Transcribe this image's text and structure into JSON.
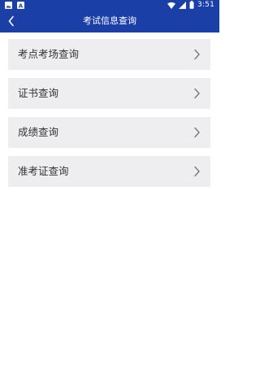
{
  "status_bar": {
    "time": "3:51",
    "left_icons": [
      "image-icon",
      "font-icon"
    ],
    "right_icons": [
      "wifi-icon",
      "signal-icon",
      "battery-icon"
    ]
  },
  "app_bar": {
    "title": "考试信息查询",
    "back_icon": "chevron-left-icon",
    "background": "#1a3fa6"
  },
  "menu": {
    "items": [
      {
        "label": "考点考场查询",
        "icon": "chevron-right-icon"
      },
      {
        "label": "证书查询",
        "icon": "chevron-right-icon"
      },
      {
        "label": "成绩查询",
        "icon": "chevron-right-icon"
      },
      {
        "label": "准考证查询",
        "icon": "chevron-right-icon"
      }
    ]
  }
}
